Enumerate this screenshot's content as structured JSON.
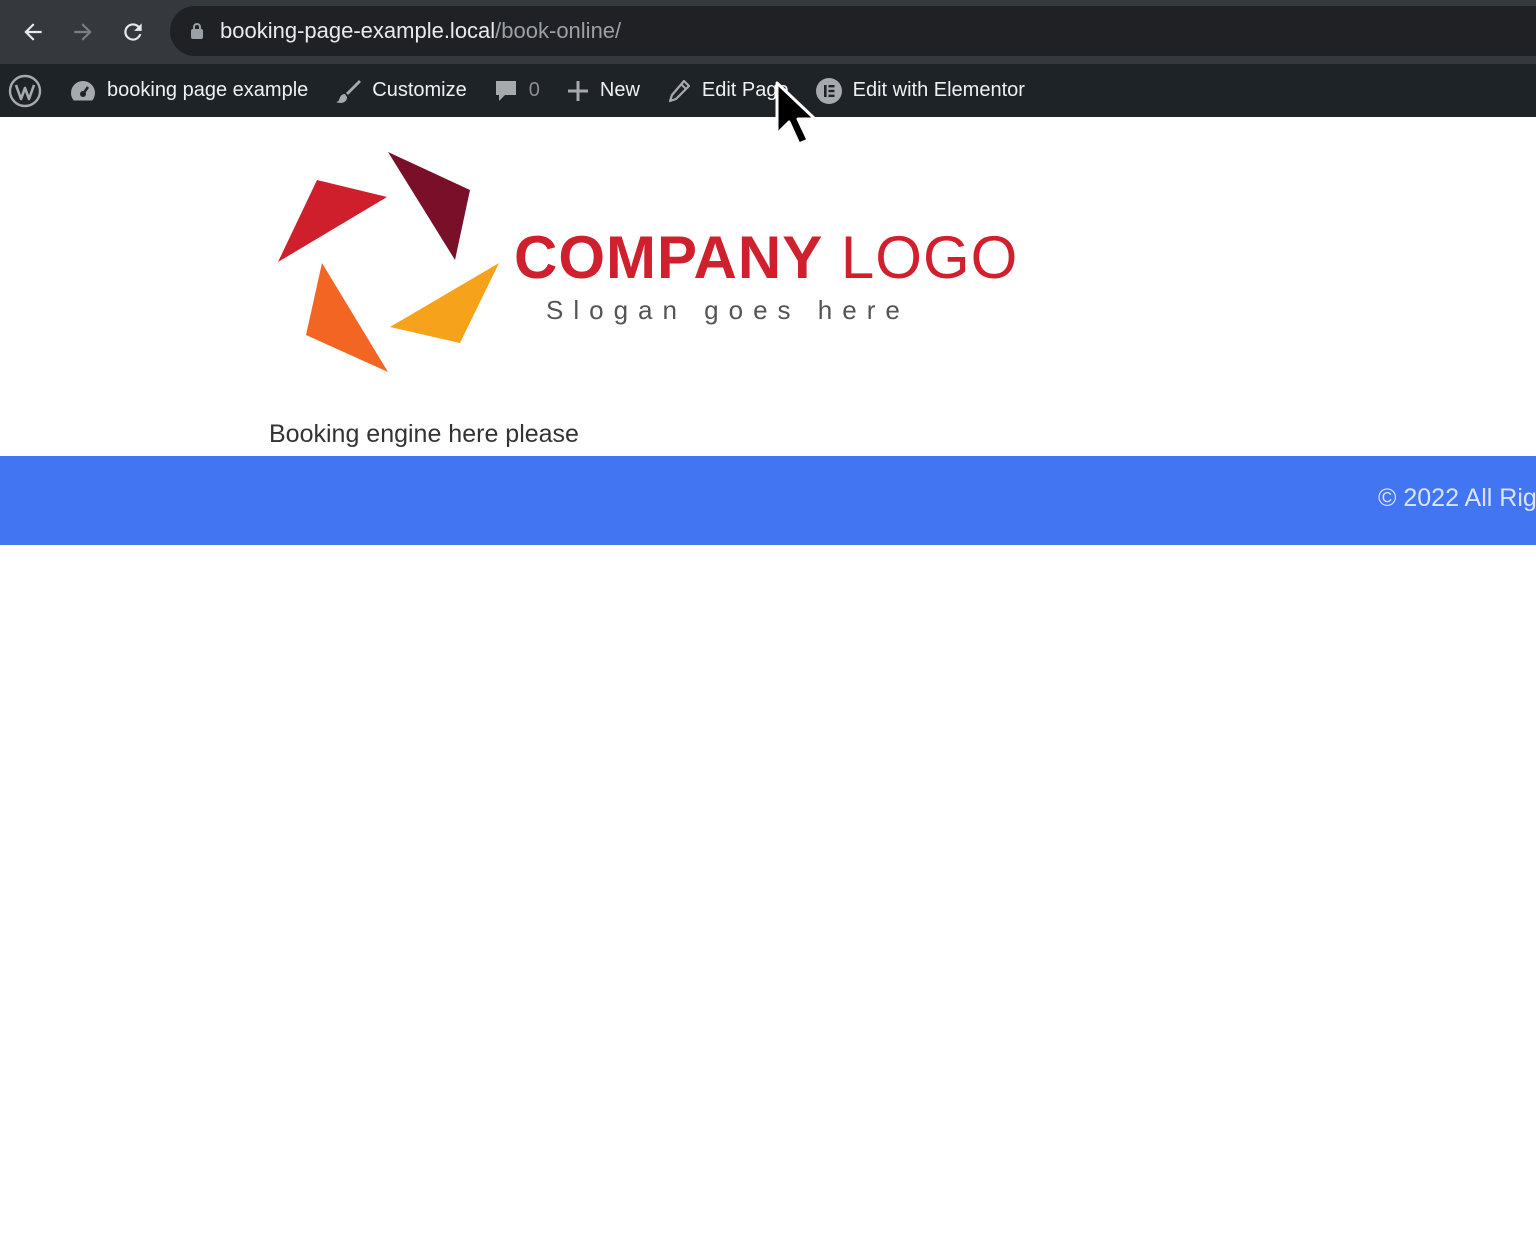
{
  "browser": {
    "url_host": "booking-page-example.local",
    "url_path": "/book-online/",
    "icons": [
      "back-arrow-icon",
      "forward-arrow-icon",
      "reload-icon",
      "lock-icon"
    ]
  },
  "admin_bar": {
    "site_name": "booking page example",
    "customize": "Customize",
    "comments_count": "0",
    "new": "New",
    "edit_page": "Edit Page",
    "edit_elementor": "Edit with Elementor",
    "background": "#1d2327"
  },
  "logo": {
    "word1": "COMPANY",
    "word2": "LOGO",
    "slogan": "Slogan goes here",
    "colors": [
      "#cf1f2d",
      "#7a0f2a",
      "#f26522",
      "#f7a21b"
    ]
  },
  "content": {
    "text": "Booking engine here please"
  },
  "footer": {
    "copyright": "© 2022 All Rig",
    "background": "#4175f2"
  }
}
